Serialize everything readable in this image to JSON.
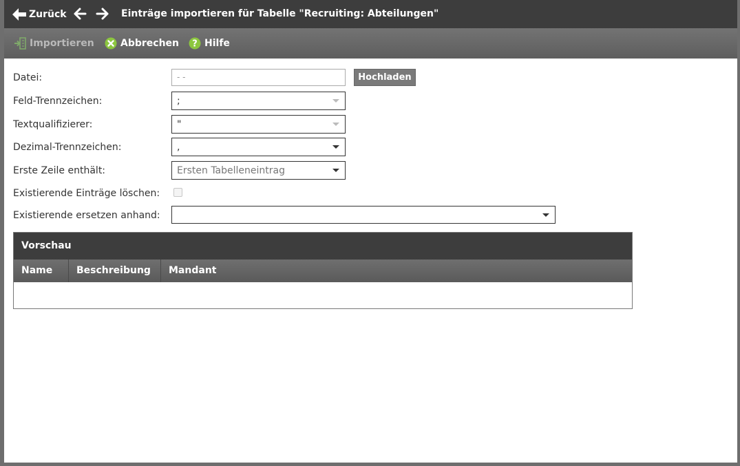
{
  "header": {
    "back_label": "Zurück",
    "title": "Einträge importieren für Tabelle \"Recruiting: Abteilungen\""
  },
  "toolbar": {
    "import_label": "Importieren",
    "cancel_label": "Abbrechen",
    "help_label": "Hilfe"
  },
  "form": {
    "file": {
      "label": "Datei:",
      "value": "- -",
      "upload_label": "Hochladen"
    },
    "field_separator": {
      "label": "Feld-Trennzeichen:",
      "value": ";"
    },
    "text_qualifier": {
      "label": "Textqualifizierer:",
      "value": "\""
    },
    "decimal_separator": {
      "label": "Dezimal-Trennzeichen:",
      "value": ","
    },
    "first_row": {
      "label": "Erste Zeile enthält:",
      "value": "Ersten Tabelleneintrag"
    },
    "delete_existing": {
      "label": "Existierende Einträge löschen:",
      "checked": false
    },
    "replace_by": {
      "label": "Existierende ersetzen anhand:",
      "value": ""
    }
  },
  "preview": {
    "title": "Vorschau",
    "columns": [
      "Name",
      "Beschreibung",
      "Mandant"
    ]
  },
  "colors": {
    "titlebar": "#3d3d3d",
    "toolbar": "#666666",
    "cancel_icon": "#8cc63f",
    "help_icon": "#8cc63f",
    "import_icon_disabled": "#7fa96a"
  }
}
